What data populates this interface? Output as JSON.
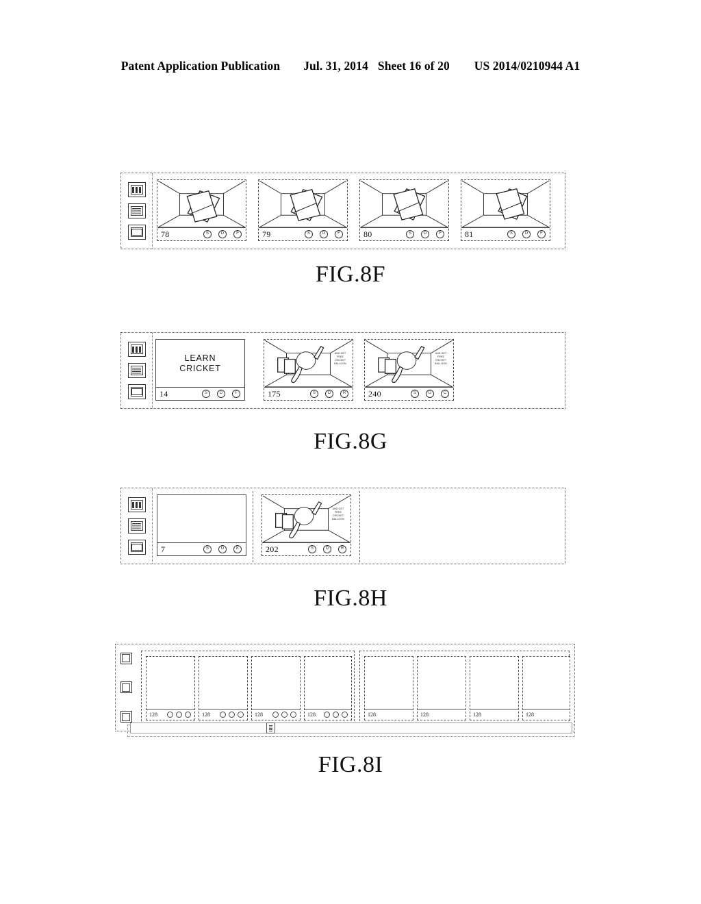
{
  "header": {
    "publication": "Patent Application Publication",
    "date": "Jul. 31, 2014",
    "sheet": "Sheet 16 of 20",
    "number": "US 2014/0210944 A1"
  },
  "figures": [
    {
      "id": "fig-8f",
      "caption": "FIG.8F",
      "sidebar_icons": [
        "panels-icon",
        "document-icon",
        "film-icon"
      ],
      "cards": [
        {
          "number": "78",
          "art": "room-with-cards",
          "badges": [
            "S",
            "D",
            "F"
          ]
        },
        {
          "number": "79",
          "art": "room-with-cards",
          "badges": [
            "S",
            "D",
            "F"
          ]
        },
        {
          "number": "80",
          "art": "room-with-cards",
          "badges": [
            "S",
            "D",
            "F"
          ]
        },
        {
          "number": "81",
          "art": "room-with-cards",
          "badges": [
            "S",
            "D",
            "F"
          ]
        }
      ]
    },
    {
      "id": "fig-8g",
      "caption": "FIG.8G",
      "sidebar_icons": [
        "panels-icon",
        "document-icon",
        "film-icon"
      ],
      "cards": [
        {
          "number": "14",
          "art": "text",
          "text_lines": [
            "LEARN",
            "CRICKET"
          ],
          "badges": [
            "S",
            "D",
            "F"
          ]
        },
        {
          "number": "175",
          "art": "room-with-bat-ball",
          "ad_lines": [
            "AND GET",
            "FREE",
            "CRICKET",
            "BALLOON"
          ],
          "badges": [
            "S",
            "D",
            "R"
          ]
        },
        {
          "number": "240",
          "art": "room-with-bat-ball",
          "ad_lines": [
            "AND GET",
            "FREE",
            "CRICKET",
            "BALLOON"
          ],
          "badges": [
            "S",
            "D",
            "C"
          ]
        }
      ]
    },
    {
      "id": "fig-8h",
      "caption": "FIG.8H",
      "sidebar_icons": [
        "panels-icon",
        "document-icon",
        "film-icon"
      ],
      "cards": [
        {
          "number": "7",
          "art": "blank",
          "badges": [
            "S",
            "D",
            "K"
          ]
        },
        {
          "number": "202",
          "art": "room-with-bat-ball",
          "ad_lines": [
            "AND GET",
            "FREE",
            "CRICKET",
            "BALLOON"
          ],
          "badges": [
            "S",
            "D",
            "R"
          ]
        }
      ]
    },
    {
      "id": "fig-8i",
      "caption": "FIG.8I",
      "sidebar_icons": [
        "grid-icon",
        "window-icon",
        "list-icon"
      ],
      "groups": [
        {
          "name": "left-group",
          "cards": [
            {
              "number": "128",
              "badges": [
                "o",
                "o",
                "o"
              ]
            },
            {
              "number": "128",
              "badges": [
                "o",
                "o",
                "o"
              ]
            },
            {
              "number": "128",
              "badges": [
                "o",
                "o",
                "o"
              ]
            },
            {
              "number": "128",
              "badges": [
                "o",
                "o",
                "o"
              ]
            }
          ]
        },
        {
          "name": "right-group",
          "cards": [
            {
              "number": "128",
              "badges": []
            },
            {
              "number": "128",
              "badges": []
            },
            {
              "number": "128",
              "badges": []
            },
            {
              "number": "128",
              "badges": []
            }
          ]
        }
      ],
      "scrollbar": {
        "orientation": "horizontal",
        "thumb_position_pct": 31
      }
    }
  ]
}
